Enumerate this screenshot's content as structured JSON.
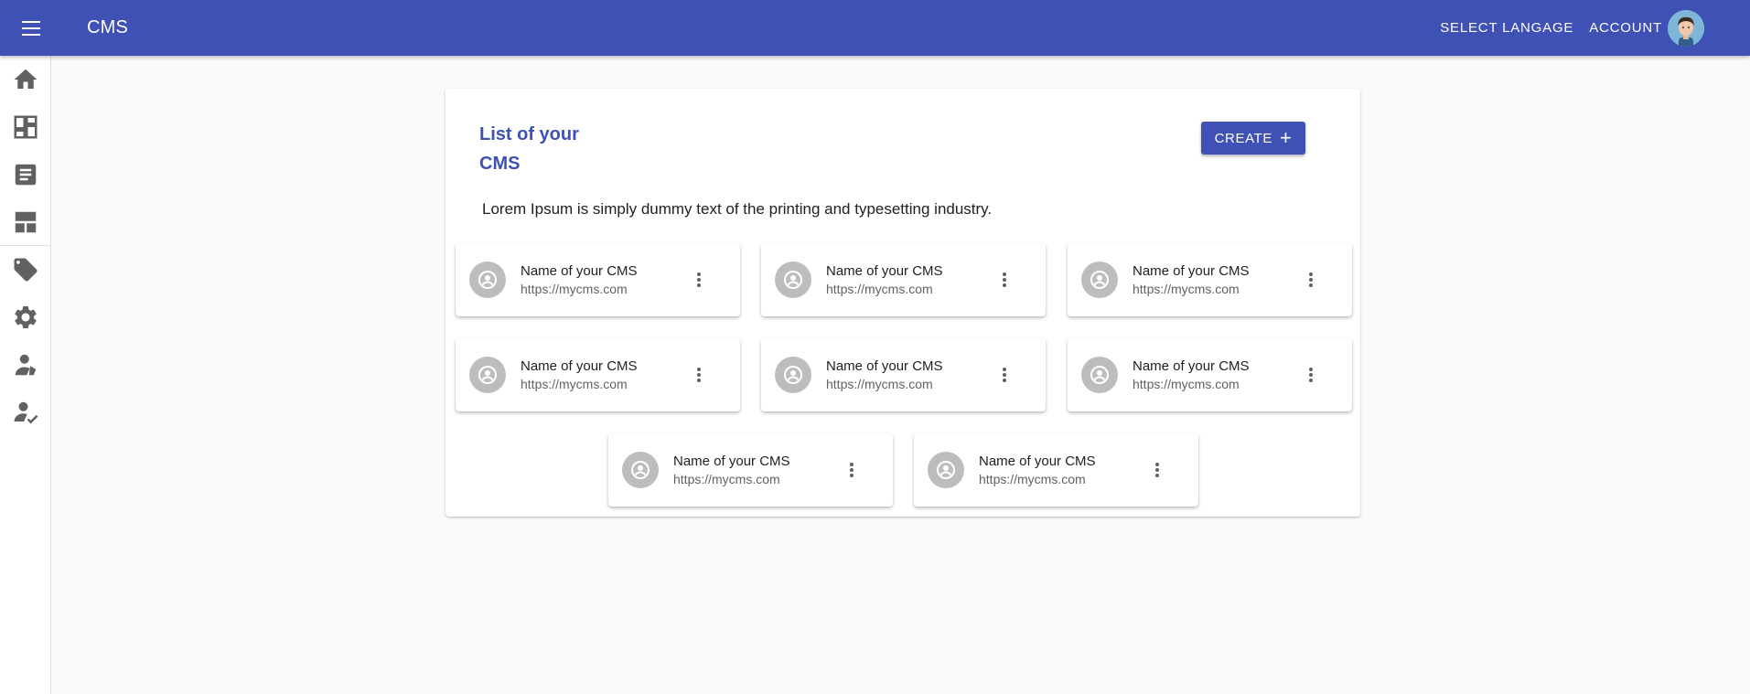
{
  "appbar": {
    "title": "CMS",
    "select_language": "SELECT LANGAGE",
    "account": "ACCOUNT"
  },
  "sidebar": {
    "items": [
      {
        "icon": "home-icon"
      },
      {
        "icon": "dashboard-icon"
      },
      {
        "icon": "article-icon"
      },
      {
        "icon": "layout-icon"
      },
      {
        "icon": "tags-icon"
      },
      {
        "icon": "settings-icon"
      },
      {
        "icon": "users-icon"
      },
      {
        "icon": "user-check-icon"
      }
    ]
  },
  "main": {
    "title": "List of your CMS",
    "create_label": "CREATE",
    "create_icon": "plus-icon",
    "description": "Lorem Ipsum is simply dummy text of the printing and typesetting industry.",
    "cards": [
      {
        "name": "Name of your CMS",
        "url": "https://mycms.com"
      },
      {
        "name": "Name of your CMS",
        "url": "https://mycms.com"
      },
      {
        "name": "Name of your CMS",
        "url": "https://mycms.com"
      },
      {
        "name": "Name of your CMS",
        "url": "https://mycms.com"
      },
      {
        "name": "Name of your CMS",
        "url": "https://mycms.com"
      },
      {
        "name": "Name of your CMS",
        "url": "https://mycms.com"
      },
      {
        "name": "Name of your CMS",
        "url": "https://mycms.com"
      },
      {
        "name": "Name of your CMS",
        "url": "https://mycms.com"
      }
    ]
  },
  "colors": {
    "primary": "#3f51b5",
    "icon_grey": "#616161",
    "avatar_grey": "#bdbdbd",
    "background": "#fafafa"
  }
}
